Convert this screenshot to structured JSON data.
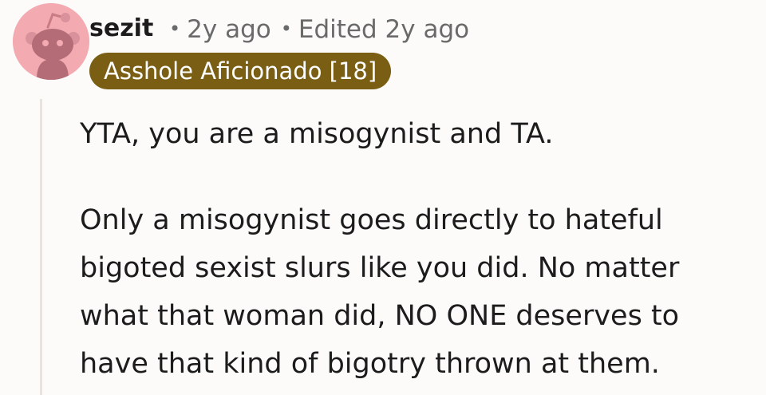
{
  "comment": {
    "username": "sezit",
    "posted": "2y ago",
    "edited": "Edited 2y ago",
    "flair": "Asshole Aficionado [18]",
    "paragraphs": [
      "YTA, you are a misogynist and TA.",
      "Only a misogynist goes directly to hateful bigoted sexist slurs like you did. No matter what that woman did, NO ONE deserves to have that kind of bigotry thrown at them."
    ]
  },
  "icons": {
    "avatar": "snoo-avatar-icon",
    "separator": "dot-separator"
  },
  "colors": {
    "avatar_bg": "#f3aab0",
    "flair_bg": "#7a5e14",
    "meta_text": "#6a6a6a",
    "thread_line": "#e7e3df"
  }
}
